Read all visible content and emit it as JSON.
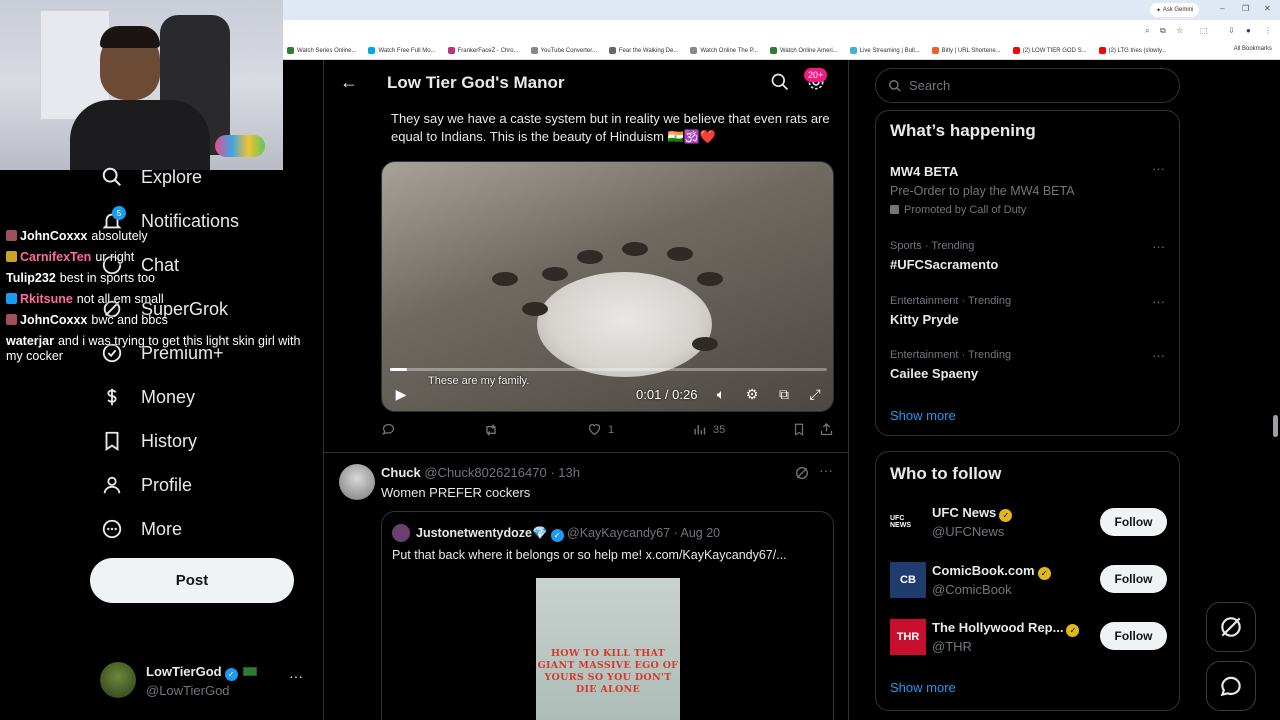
{
  "browser": {
    "ask_gemini": "Ask Gemini",
    "all_bookmarks": "All Bookmarks",
    "bookmarks": [
      {
        "label": "Watch Series Online...",
        "color": "#2e7d32"
      },
      {
        "label": "Watch Free Full Mo...",
        "color": "#00a8e8"
      },
      {
        "label": "FrankerFaceZ - Chro...",
        "color": "#b83280"
      },
      {
        "label": "YouTube Converter...",
        "color": "#888888"
      },
      {
        "label": "Fear the Walking De...",
        "color": "#666666"
      },
      {
        "label": "Watch Online The P...",
        "color": "#888888"
      },
      {
        "label": "Watch Online Ameri...",
        "color": "#2e7d32"
      },
      {
        "label": "Live Streaming | Bull...",
        "color": "#3fb0d9"
      },
      {
        "label": "Bitly | URL Shortene...",
        "color": "#ee6123"
      },
      {
        "label": "(2) LOW TIER GOD S...",
        "color": "#ff0000"
      },
      {
        "label": "(2) LTG tries (slowly...",
        "color": "#ff0000"
      }
    ]
  },
  "nav": {
    "explore": "Explore",
    "notifications": "Notifications",
    "notifications_count": "5",
    "chat": "Chat",
    "supergrok": "SuperGrok",
    "premium": "Premium+",
    "money": "Money",
    "history": "History",
    "profile": "Profile",
    "more": "More",
    "post": "Post"
  },
  "account": {
    "name": "LowTierGod",
    "handle": "@LowTierGod"
  },
  "chat_overlay": [
    {
      "user": "JohnCoxxx",
      "color": "#ffffff",
      "badge": "#a0505a",
      "text": "absolutely"
    },
    {
      "user": "CarnifexTen",
      "color": "#ff6b9a",
      "badge": "#c9a227",
      "text": "ur right"
    },
    {
      "user": "Tulip232",
      "color": "#ffffff",
      "badge": "",
      "text": "best in sports too"
    },
    {
      "user": "Rkitsune",
      "color": "#ff6b9a",
      "badge": "#1d9bf0",
      "text": "not all em small"
    },
    {
      "user": "JohnCoxxx",
      "color": "#ffffff",
      "badge": "#a0505a",
      "text": "bwc and bbcs"
    },
    {
      "user": "waterjar",
      "color": "#ffffff",
      "badge": "",
      "text": "and i was trying to get this light skin girl with my cocker"
    }
  ],
  "header": {
    "title": "Low Tier God's Manor",
    "badge": "20+"
  },
  "tweet1": {
    "text": "They say we have a caste system but in reality we believe that even rats are equal to Indians. This is the beauty of Hinduism 🇮🇳🕉️❤️",
    "video_caption": "These are my family.",
    "video_time": "0:01 / 0:26",
    "video_progress": 0.04,
    "likes": "1",
    "views": "35"
  },
  "tweet2": {
    "name": "Chuck",
    "handle": "@Chuck8026216470",
    "time": "· 13h",
    "text": "Women PREFER cockers",
    "quote": {
      "name": "Justonetwentydoze💎",
      "handle": "@KayKaycandy67",
      "time": "· Aug 20",
      "text": "Put that back where it belongs or so help me!  x.com/KayKaycandy67/...",
      "image_text": "HOW TO KILL THAT GIANT MASSIVE EGO OF YOURS SO YOU DON'T DIE ALONE"
    }
  },
  "search": {
    "placeholder": "Search"
  },
  "whats_happening": {
    "title": "What’s happening",
    "promo": {
      "name": "MW4 BETA",
      "sub": "Pre-Order to play the MW4 BETA",
      "promoted": "Promoted by Call of Duty"
    },
    "trends": [
      {
        "meta": "Sports · Trending",
        "name": "#UFCSacramento"
      },
      {
        "meta": "Entertainment · Trending",
        "name": "Kitty Pryde"
      },
      {
        "meta": "Entertainment · Trending",
        "name": "Cailee Spaeny"
      }
    ],
    "show_more": "Show more"
  },
  "who_to_follow": {
    "title": "Who to follow",
    "accounts": [
      {
        "name": "UFC News",
        "handle": "@UFCNews",
        "logo": "UFC NEWS",
        "logo_bg": "#000000",
        "logo_fg": "#ffffff"
      },
      {
        "name": "ComicBook.com",
        "handle": "@ComicBook",
        "logo": "CB",
        "logo_bg": "#1f3c6e",
        "logo_fg": "#ffffff"
      },
      {
        "name": "The Hollywood Rep...",
        "handle": "@THR",
        "logo": "THR",
        "logo_bg": "#c8102e",
        "logo_fg": "#ffffff"
      }
    ],
    "follow_label": "Follow",
    "show_more": "Show more"
  }
}
